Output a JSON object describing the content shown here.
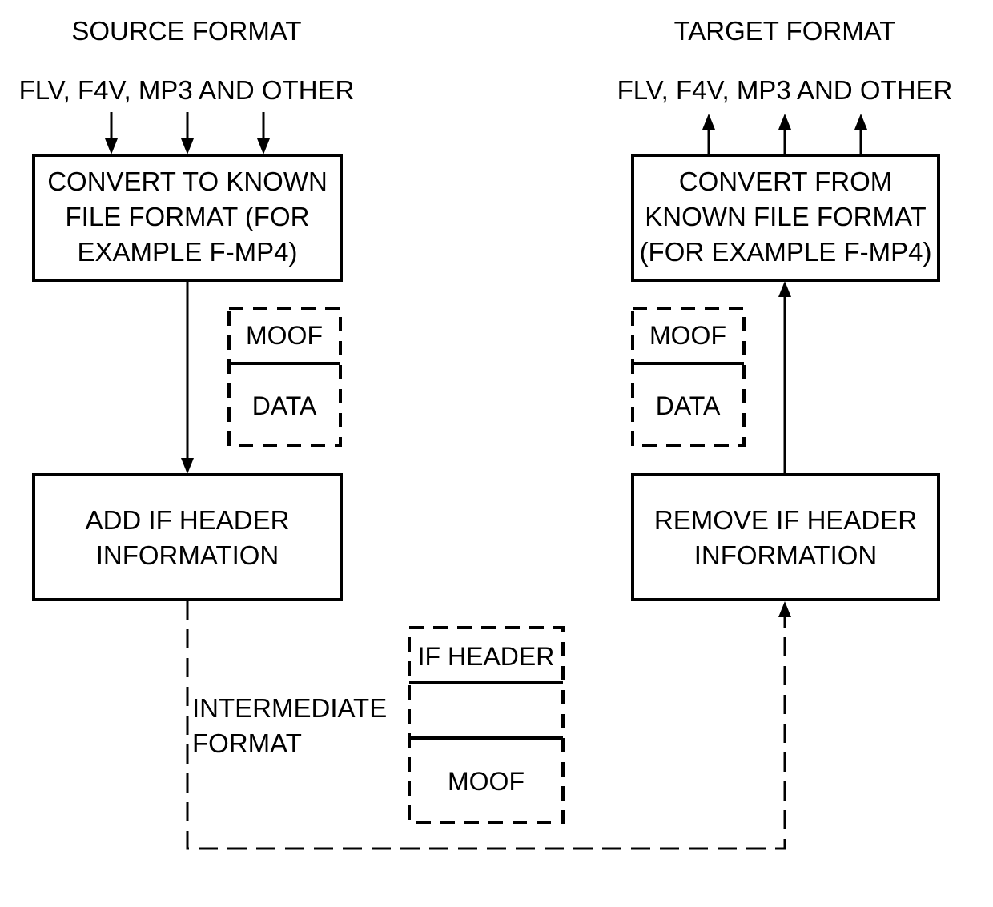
{
  "diagram": {
    "source": {
      "title": "SOURCE FORMAT",
      "formats": "FLV, F4V, MP3 AND OTHER",
      "convert_box": [
        "CONVERT TO KNOWN",
        "FILE FORMAT (FOR",
        "EXAMPLE F-MP4)"
      ],
      "fragment": {
        "top": "MOOF",
        "bottom": "DATA"
      },
      "add_box": [
        "ADD IF HEADER",
        "INFORMATION"
      ]
    },
    "target": {
      "title": "TARGET FORMAT",
      "formats": "FLV, F4V, MP3 AND OTHER",
      "convert_box": [
        "CONVERT FROM",
        "KNOWN FILE FORMAT",
        "(FOR EXAMPLE F-MP4)"
      ],
      "fragment": {
        "top": "MOOF",
        "bottom": "DATA"
      },
      "remove_box": [
        "REMOVE IF HEADER",
        "INFORMATION"
      ]
    },
    "intermediate": {
      "label": [
        "INTERMEDIATE",
        "FORMAT"
      ],
      "packet": {
        "top": "IF HEADER",
        "middle": "",
        "bottom": "MOOF"
      }
    }
  }
}
